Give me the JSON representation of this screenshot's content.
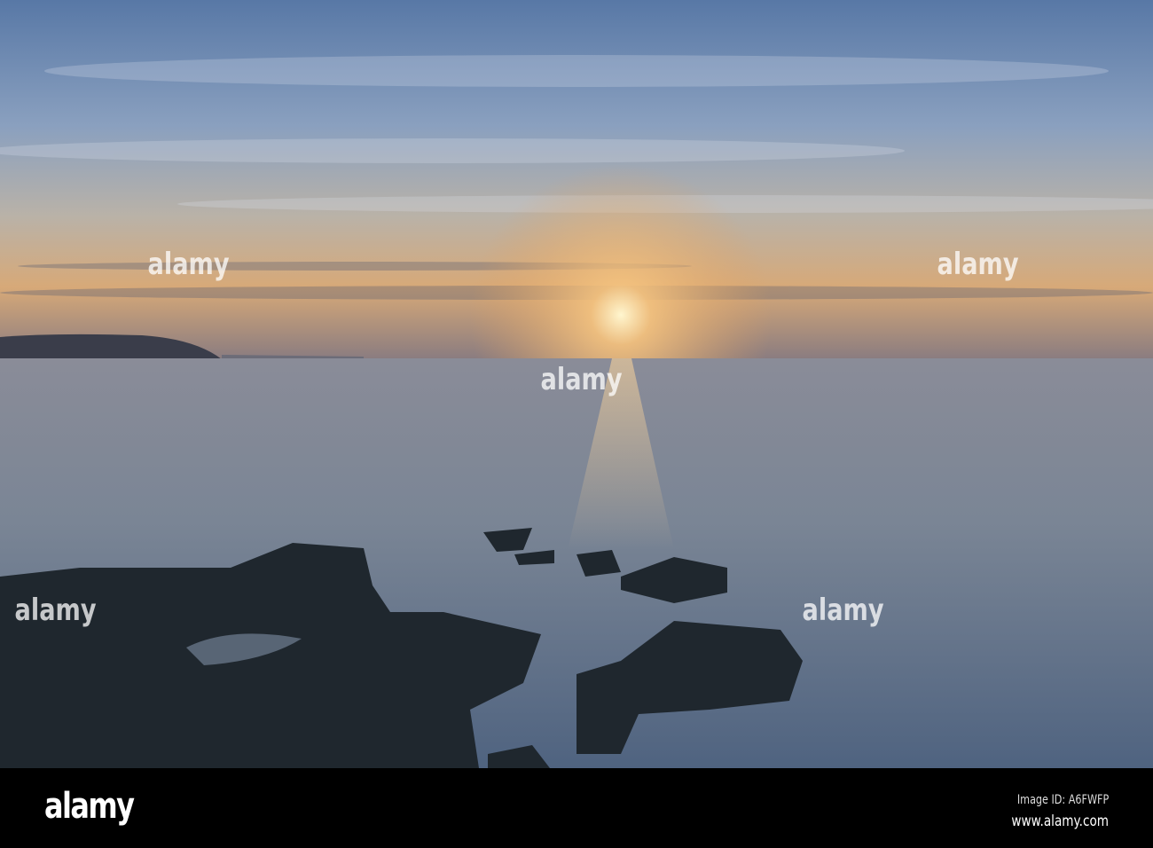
{
  "photo": {
    "subject": "sunset-over-sea-with-rocks",
    "colors": {
      "sky_top": "#5f7fab",
      "sky_glow": "#e8b070",
      "sun": "#fff2c0",
      "sea": "#6f7f95",
      "rocks": "#1e262c"
    }
  },
  "watermark": {
    "text": "alamy"
  },
  "footer": {
    "logo": "alamy",
    "image_id": "Image ID: A6FWFP",
    "website": "www.alamy.com"
  }
}
